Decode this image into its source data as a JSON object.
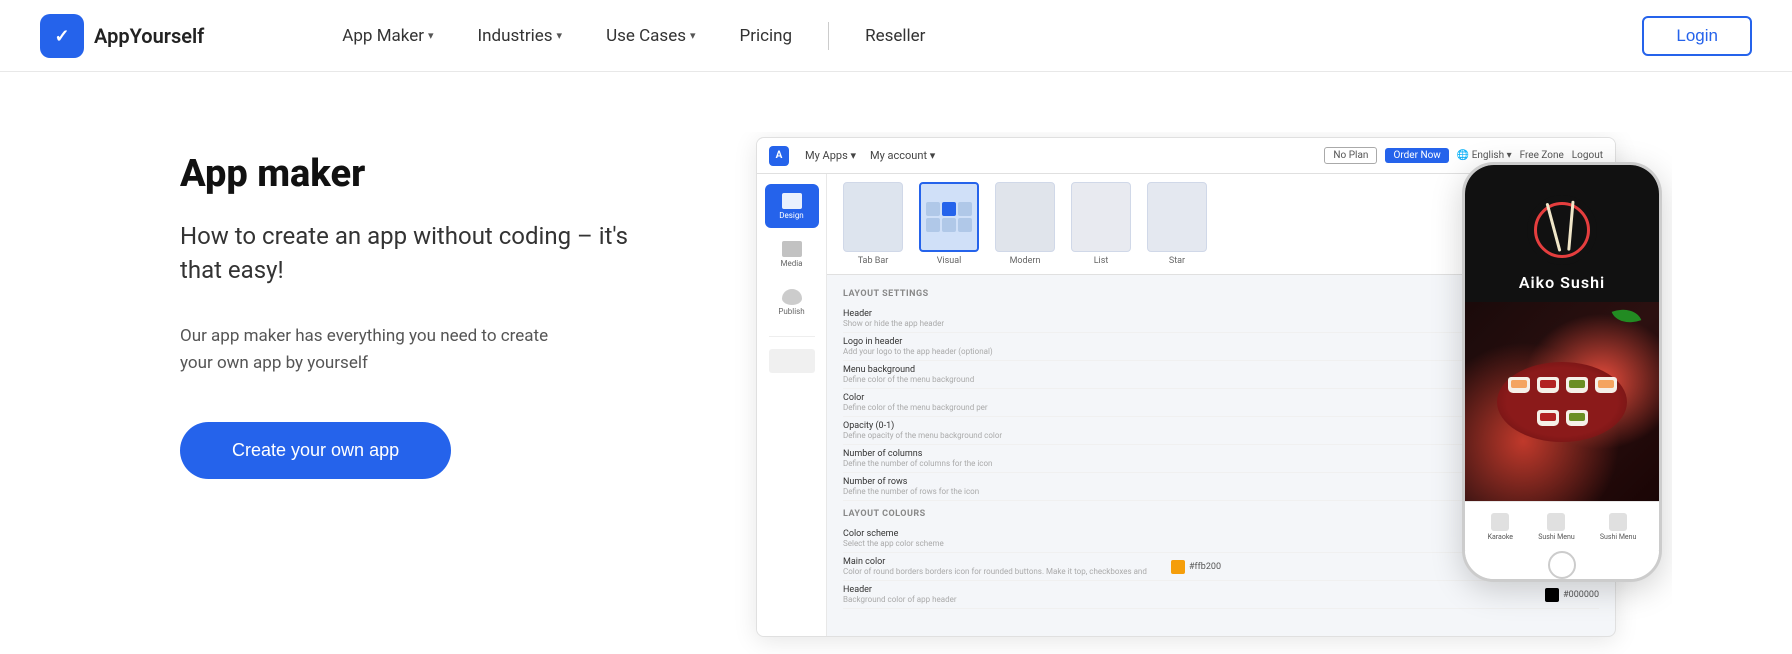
{
  "brand": {
    "name": "AppYourself",
    "logo_char": "✓"
  },
  "nav": {
    "items": [
      {
        "label": "App Maker",
        "has_dropdown": true
      },
      {
        "label": "Industries",
        "has_dropdown": true
      },
      {
        "label": "Use Cases",
        "has_dropdown": true
      },
      {
        "label": "Pricing",
        "has_dropdown": false
      },
      {
        "label": "Reseller",
        "has_dropdown": false
      }
    ],
    "login_label": "Login"
  },
  "hero": {
    "title": "App maker",
    "subtitle": "How to create an app without coding – it's that easy!",
    "description": "Our app maker has everything you need to create your own app by yourself",
    "cta_label": "Create your own app"
  },
  "mockup": {
    "topbar": {
      "logo": "A",
      "nav_items": [
        "My Apps ▾",
        "My account ▾"
      ],
      "right_items": [
        "No Plan",
        "Order Now",
        "English ▾",
        "Free Zone",
        "Logout"
      ]
    },
    "sidebar_items": [
      "Design",
      "Media",
      "Publish"
    ],
    "templates": [
      {
        "label": "Tab Bar",
        "selected": false
      },
      {
        "label": "Visual",
        "selected": true
      },
      {
        "label": "Modern",
        "selected": false
      },
      {
        "label": "List",
        "selected": false
      },
      {
        "label": "Star",
        "selected": false
      }
    ],
    "settings_section": "LAYOUT SETTINGS",
    "settings_rows": [
      {
        "label": "Header",
        "sublabel": "Show or hide the app header",
        "control": "hide_btn"
      },
      {
        "label": "Logo in header",
        "sublabel": "Add your logo to the app header (optional)",
        "control": "upload_btn"
      },
      {
        "label": "Menu background",
        "sublabel": "Define color of the menu background",
        "control": "none_solid_gradient"
      },
      {
        "label": "Color",
        "sublabel": "Define color of the menu background per",
        "control": "color_black"
      },
      {
        "label": "Opacity (0-1)",
        "sublabel": "Define opacity of the menu background color",
        "control": "slider"
      },
      {
        "label": "Number of columns",
        "sublabel": "Define the number of columns for the icon",
        "control": "num_3"
      },
      {
        "label": "Number of rows",
        "sublabel": "Define the number of rows for the icon",
        "control": "num_1_2_3"
      }
    ],
    "colors_section": "LAYOUT COLOURS",
    "color_rows": [
      {
        "label": "Color scheme",
        "sublabel": "Select the app color scheme",
        "control": "bright_dark"
      },
      {
        "label": "Main color",
        "sublabel": "Color of round borders borders icon for rounded buttons. Make it top, checkboxes and",
        "color": "orange",
        "value": "#ffb200"
      },
      {
        "label": "Header",
        "sublabel": "Background color of app header",
        "color": "black",
        "value": "#000000"
      }
    ],
    "phone": {
      "restaurant_name": "Aiko Sushi",
      "nav_items": [
        "Karaoke",
        "Sushi Menu",
        "Sushi Menu"
      ]
    }
  }
}
